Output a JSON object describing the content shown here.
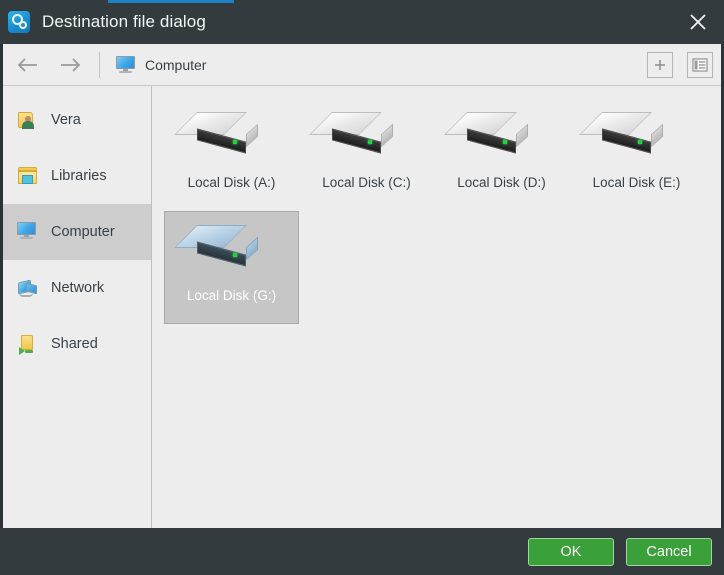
{
  "window": {
    "title": "Destination file dialog",
    "app_icon": "disk-clock-icon",
    "close_icon": "close-icon",
    "accent_color": "#1b80c4",
    "titlebar_color": "#333b3f"
  },
  "toolbar": {
    "back_icon": "arrow-left-icon",
    "forward_icon": "arrow-right-icon",
    "breadcrumb": {
      "icon": "monitor-icon",
      "label": "Computer"
    },
    "new_folder_icon": "plus-box-icon",
    "view_mode_icon": "list-view-icon"
  },
  "sidebar": {
    "items": [
      {
        "label": "Vera",
        "icon": "user-folder-icon",
        "selected": false
      },
      {
        "label": "Libraries",
        "icon": "libraries-icon",
        "selected": false
      },
      {
        "label": "Computer",
        "icon": "monitor-icon",
        "selected": true
      },
      {
        "label": "Network",
        "icon": "network-icon",
        "selected": false
      },
      {
        "label": "Shared",
        "icon": "shared-folder-icon",
        "selected": false
      }
    ]
  },
  "content": {
    "items": [
      {
        "label": "Local Disk (A:)",
        "icon": "disk-drive-icon",
        "selected": false
      },
      {
        "label": "Local Disk (C:)",
        "icon": "disk-drive-icon",
        "selected": false
      },
      {
        "label": "Local Disk (D:)",
        "icon": "disk-drive-icon",
        "selected": false
      },
      {
        "label": "Local Disk (E:)",
        "icon": "disk-drive-icon",
        "selected": false
      },
      {
        "label": "Local Disk (G:)",
        "icon": "disk-drive-icon",
        "selected": true
      }
    ]
  },
  "footer": {
    "ok_label": "OK",
    "cancel_label": "Cancel",
    "button_color": "#3aa03a"
  }
}
